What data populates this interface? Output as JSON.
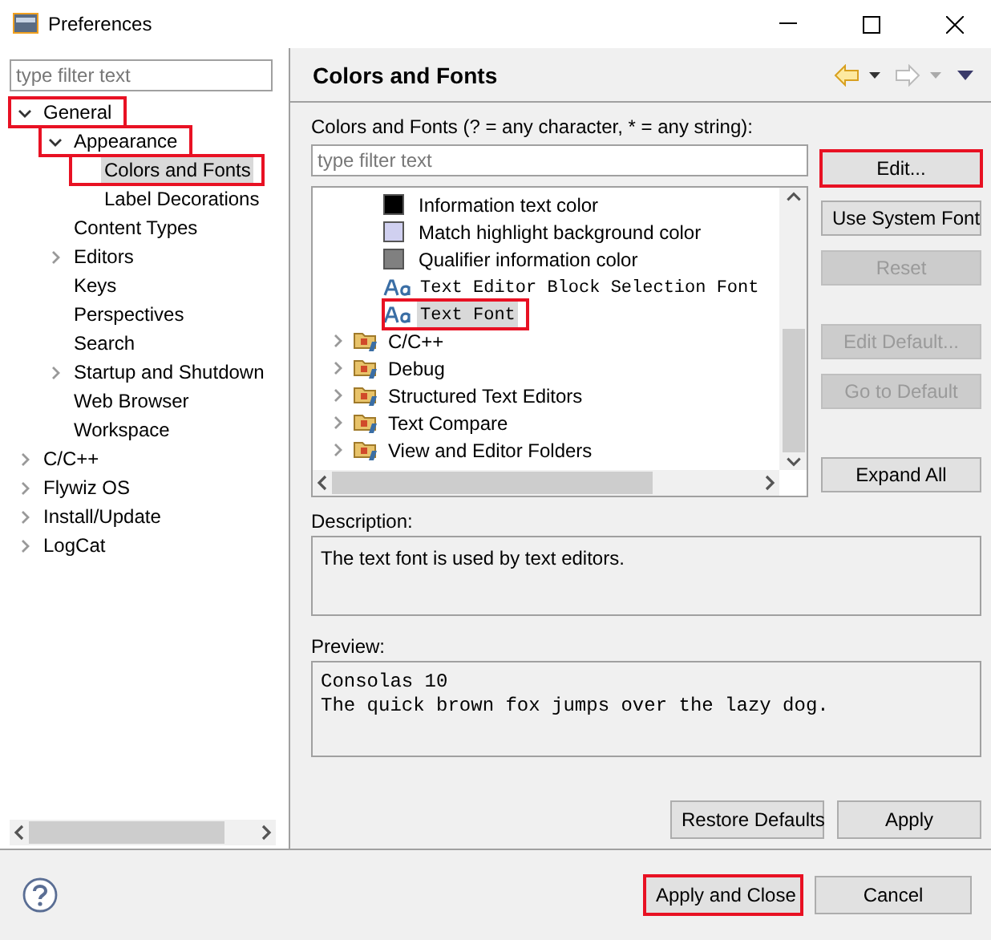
{
  "window": {
    "title": "Preferences"
  },
  "sidebar": {
    "filter": {
      "placeholder": "type filter text"
    },
    "items": [
      {
        "label": "General",
        "kind": "branch",
        "expanded": true,
        "selected": false,
        "highlighted": true,
        "children": [
          {
            "label": "Appearance",
            "kind": "branch",
            "expanded": true,
            "selected": false,
            "highlighted": true,
            "children": [
              {
                "label": "Colors and Fonts",
                "kind": "leaf",
                "selected": true,
                "highlighted": true
              },
              {
                "label": "Label Decorations",
                "kind": "leaf",
                "selected": false,
                "highlighted": false
              }
            ]
          },
          {
            "label": "Content Types",
            "kind": "leaf",
            "selected": false,
            "highlighted": false
          },
          {
            "label": "Editors",
            "kind": "branch",
            "expanded": false,
            "selected": false,
            "highlighted": false
          },
          {
            "label": "Keys",
            "kind": "leaf",
            "selected": false,
            "highlighted": false
          },
          {
            "label": "Perspectives",
            "kind": "leaf",
            "selected": false,
            "highlighted": false
          },
          {
            "label": "Search",
            "kind": "leaf",
            "selected": false,
            "highlighted": false
          },
          {
            "label": "Startup and Shutdown",
            "kind": "branch",
            "expanded": false,
            "selected": false,
            "highlighted": false
          },
          {
            "label": "Web Browser",
            "kind": "leaf",
            "selected": false,
            "highlighted": false
          },
          {
            "label": "Workspace",
            "kind": "leaf",
            "selected": false,
            "highlighted": false
          }
        ]
      },
      {
        "label": "C/C++",
        "kind": "branch",
        "expanded": false,
        "selected": false,
        "highlighted": false
      },
      {
        "label": "Flywiz OS",
        "kind": "branch",
        "expanded": false,
        "selected": false,
        "highlighted": false
      },
      {
        "label": "Install/Update",
        "kind": "branch",
        "expanded": false,
        "selected": false,
        "highlighted": false
      },
      {
        "label": "LogCat",
        "kind": "branch",
        "expanded": false,
        "selected": false,
        "highlighted": false
      }
    ]
  },
  "page": {
    "title": "Colors and Fonts",
    "filter_label": "Colors and Fonts (? = any character, * = any string):",
    "filter": {
      "placeholder": "type filter text"
    },
    "tree": [
      {
        "label": "Information text color",
        "kind": "color",
        "color": "#000000",
        "selected": false,
        "highlighted": false
      },
      {
        "label": "Match highlight background color",
        "kind": "color",
        "color": "#d0d0f0",
        "selected": false,
        "highlighted": false
      },
      {
        "label": "Qualifier information color",
        "kind": "color",
        "color": "#808080",
        "selected": false,
        "highlighted": false
      },
      {
        "label": "Text Editor Block Selection Font",
        "kind": "font",
        "selected": false,
        "highlighted": false
      },
      {
        "label": "Text Font",
        "kind": "font",
        "selected": true,
        "highlighted": true
      },
      {
        "label": "C/C++",
        "kind": "category",
        "selected": false,
        "highlighted": false
      },
      {
        "label": "Debug",
        "kind": "category",
        "selected": false,
        "highlighted": false
      },
      {
        "label": "Structured Text Editors",
        "kind": "category",
        "selected": false,
        "highlighted": false
      },
      {
        "label": "Text Compare",
        "kind": "category",
        "selected": false,
        "highlighted": false
      },
      {
        "label": "View and Editor Folders",
        "kind": "category",
        "selected": false,
        "highlighted": false
      }
    ],
    "side_buttons": [
      {
        "label": "Edit...",
        "disabled": false,
        "highlighted": true
      },
      {
        "label": "Use System Font",
        "disabled": false,
        "highlighted": false
      },
      {
        "label": "Reset",
        "disabled": true,
        "highlighted": false
      },
      {
        "label": "Edit Default...",
        "disabled": true,
        "highlighted": false
      },
      {
        "label": "Go to Default",
        "disabled": true,
        "highlighted": false
      },
      {
        "label": "Expand All",
        "disabled": false,
        "highlighted": false
      }
    ],
    "description_label": "Description:",
    "description": "The text font is used by text editors.",
    "preview_label": "Preview:",
    "preview": [
      "Consolas 10",
      "The quick brown fox jumps over the lazy dog."
    ],
    "buttons": [
      {
        "label": "Restore Defaults",
        "highlighted": false
      },
      {
        "label": "Apply",
        "highlighted": false
      }
    ]
  },
  "footer": {
    "buttons": [
      {
        "label": "Apply and Close",
        "highlighted": true
      },
      {
        "label": "Cancel",
        "highlighted": false
      }
    ]
  }
}
